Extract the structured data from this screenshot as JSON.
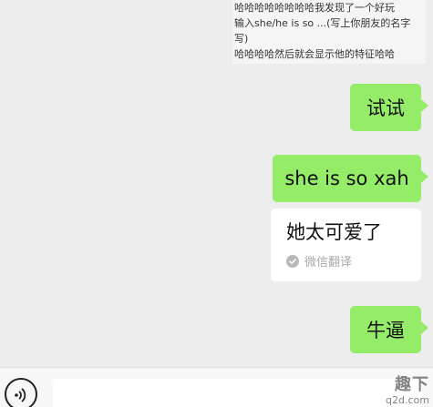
{
  "quoted_message": {
    "lines": [
      "哈哈哈哈哈哈哈哈我发现了一个好玩",
      "输入she/he is so ...(写上你朋友的名字",
      "写)",
      "哈哈哈哈然后就会显示他的特征哈哈"
    ]
  },
  "messages": [
    {
      "text": "试试"
    },
    {
      "text": "she is so xah"
    },
    {
      "text": "牛逼"
    }
  ],
  "translation": {
    "text": "她太可爱了",
    "label": "微信翻译"
  },
  "input_bar": {
    "placeholder": ""
  },
  "watermark": {
    "top": "趣下",
    "bottom": "q2d.com"
  },
  "colors": {
    "sent_bubble": "#95ec69",
    "background": "#ededed"
  }
}
